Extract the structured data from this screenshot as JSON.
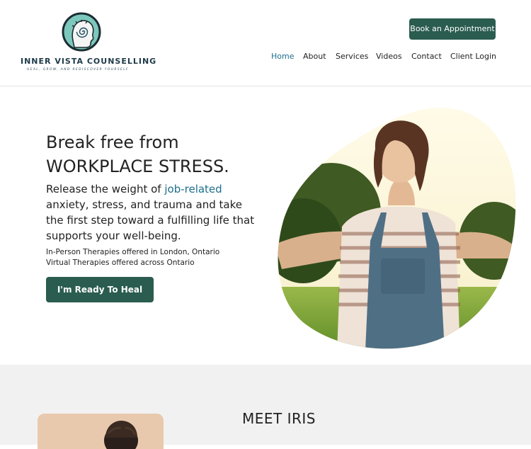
{
  "brand": {
    "name": "INNER VISTA COUNSELLING",
    "tagline": "HEAL, GROW, AND REDISCOVER YOURSELF",
    "logo_icon": "head-spiral-icon"
  },
  "header": {
    "book_label": "Book an Appointment",
    "nav": [
      {
        "label": "Home",
        "active": true
      },
      {
        "label": "About"
      },
      {
        "label": "Services"
      },
      {
        "label": "Videos"
      },
      {
        "label": "Contact"
      },
      {
        "label": "Client Login"
      }
    ]
  },
  "hero": {
    "title_line1": "Break free from",
    "title_line2": "WORKPLACE STRESS.",
    "body_pre": "Release the weight of ",
    "body_highlight": "job-related",
    "body_post": " anxiety, stress, and trauma and take the first step toward a fulfilling life that supports your well-being.",
    "note_line1": "In-Person Therapies offered in London, Ontario",
    "note_line2": "Virtual Therapies offered across Ontario",
    "cta_label": "I'm Ready To Heal"
  },
  "about": {
    "heading": "MEET IRIS"
  },
  "colors": {
    "primary": "#2a5c4f",
    "accent": "#1d6f8b",
    "logo_teal": "#7cc8bd",
    "section_bg": "#f1f1f1"
  }
}
